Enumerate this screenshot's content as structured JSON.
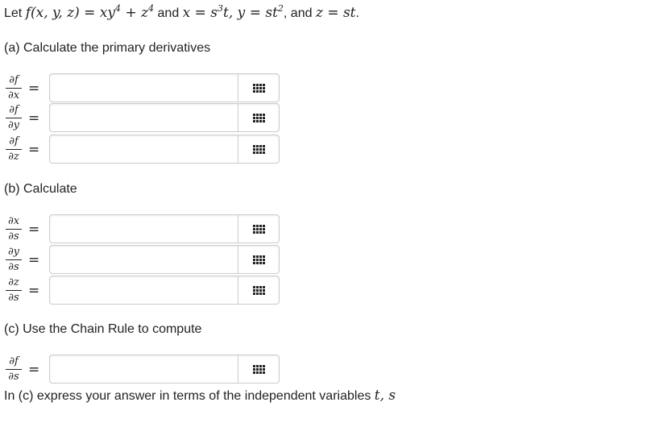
{
  "intro": {
    "let": "Let",
    "func_lhs": "f(x, y, z)",
    "equals": "=",
    "func_rhs_base": "xy",
    "func_rhs_exp1": "4",
    "plus": "+",
    "func_rhs_z": "z",
    "func_rhs_exp2": "4",
    "and1": "and",
    "x_def": "x = s",
    "x_exp": "3",
    "x_rest": "t, y = st",
    "y_exp": "2",
    "and2": ", and",
    "z_def": "z = st",
    "period": "."
  },
  "part_a": {
    "heading": "(a) Calculate the primary derivatives",
    "rows": [
      {
        "num": "∂f",
        "den": "∂x",
        "eq": "=",
        "value": "",
        "placeholder": ""
      },
      {
        "num": "∂f",
        "den": "∂y",
        "eq": "=",
        "value": "",
        "placeholder": ""
      },
      {
        "num": "∂f",
        "den": "∂z",
        "eq": "=",
        "value": "",
        "placeholder": ""
      }
    ]
  },
  "part_b": {
    "heading": "(b) Calculate",
    "rows": [
      {
        "num": "∂x",
        "den": "∂s",
        "eq": "=",
        "value": "",
        "placeholder": ""
      },
      {
        "num": "∂y",
        "den": "∂s",
        "eq": "=",
        "value": "",
        "placeholder": ""
      },
      {
        "num": "∂z",
        "den": "∂s",
        "eq": "=",
        "value": "",
        "placeholder": ""
      }
    ]
  },
  "part_c": {
    "heading": "(c) Use the Chain Rule to compute",
    "rows": [
      {
        "num": "∂f",
        "den": "∂s",
        "eq": "=",
        "value": "",
        "placeholder": ""
      }
    ],
    "note": "In (c) express your answer in terms of the independent variables",
    "note_vars": "t, s"
  },
  "icons": {
    "keypad": "grid-icon"
  }
}
